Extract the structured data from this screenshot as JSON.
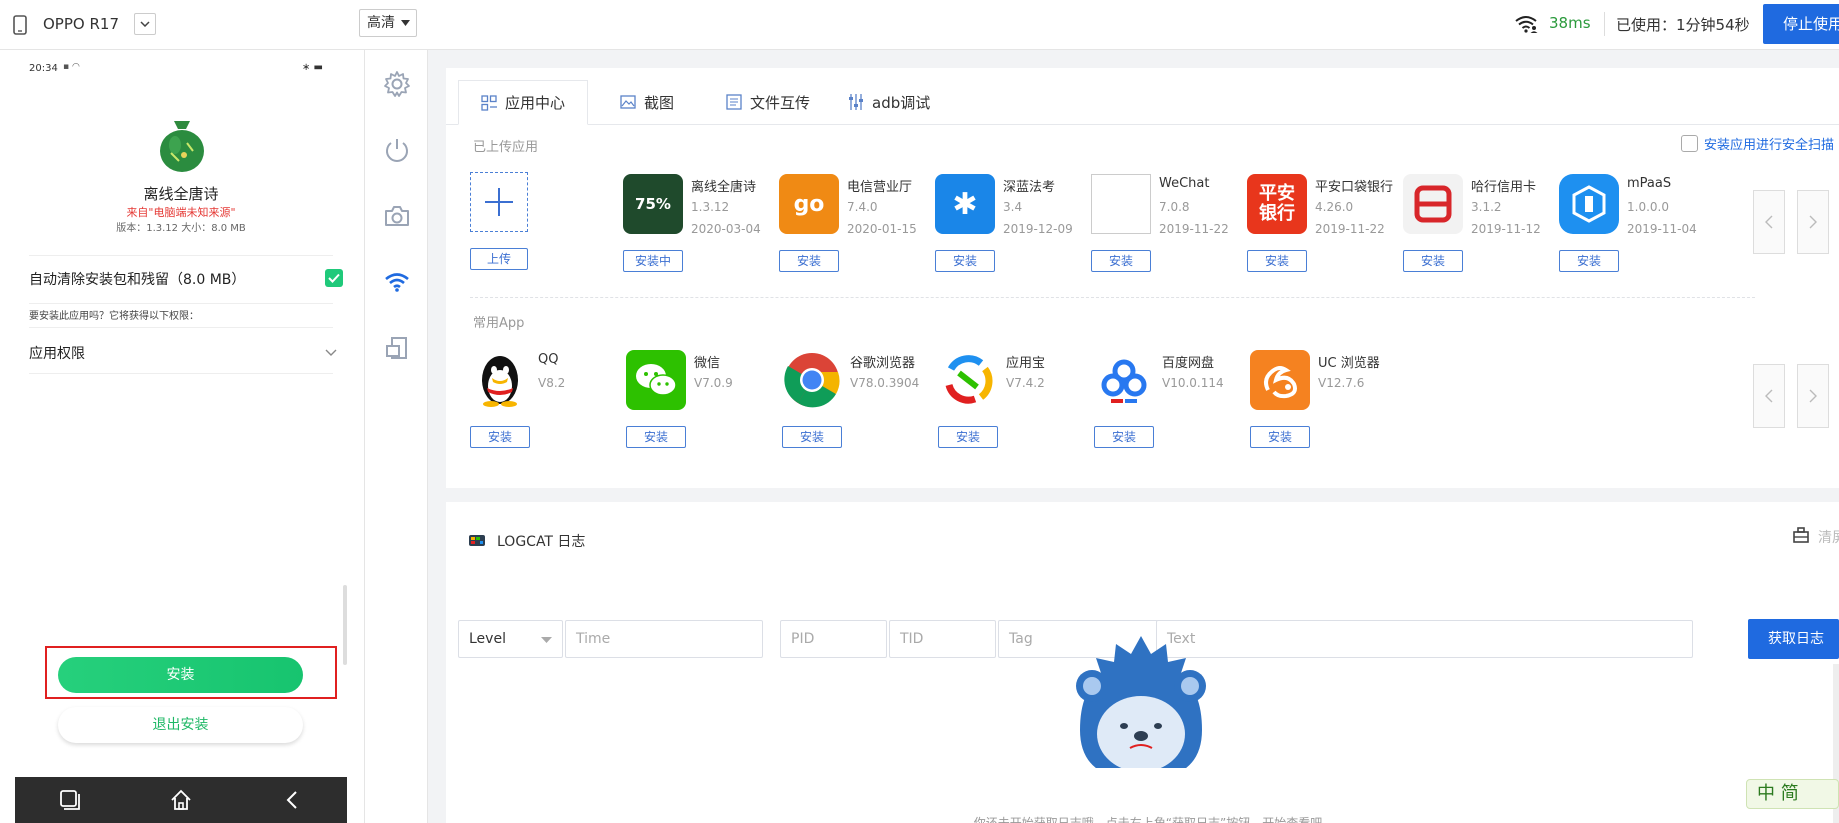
{
  "topbar": {
    "device": "OPPO R17",
    "quality": "高清",
    "latency": "38ms",
    "used_time": "已使用：1分钟54秒",
    "stop_button": "停止使用"
  },
  "phone": {
    "time": "20:34",
    "app_title": "离线全唐诗",
    "source": "来自\"电脑端未知来源\"",
    "version_info": "版本：1.3.12   大小：8.0 MB",
    "auto_clean_label": "自动清除安装包和残留（8.0 MB）",
    "permission_prompt": "要安装此应用吗？它将获得以下权限：",
    "permission_label": "应用权限",
    "install_button": "安装",
    "exit_button": "退出安装"
  },
  "tabs": [
    {
      "label": "应用中心",
      "icon": "app-center-icon"
    },
    {
      "label": "截图",
      "icon": "screenshot-icon"
    },
    {
      "label": "文件互传",
      "icon": "file-transfer-icon"
    },
    {
      "label": "adb调试",
      "icon": "adb-debug-icon"
    }
  ],
  "uploaded": {
    "section_title": "已上传应用",
    "upload_button": "上传",
    "security_scan_label": "安装应用进行安全扫描",
    "apps": [
      {
        "name": "离线全唐诗",
        "version": "1.3.12",
        "date": "2020-03-04",
        "button": "安装中",
        "progress": "75%",
        "color": "#1f4a2c"
      },
      {
        "name": "电信营业厅",
        "version": "7.4.0",
        "date": "2020-01-15",
        "button": "安装",
        "color": "#f08a14"
      },
      {
        "name": "深蓝法考",
        "version": "3.4",
        "date": "2019-12-09",
        "button": "安装",
        "color": "#1a86e8"
      },
      {
        "name": "WeChat",
        "version": "7.0.8",
        "date": "2019-11-22",
        "button": "安装",
        "color": "#ffffff"
      },
      {
        "name": "平安口袋银行",
        "version": "4.26.0",
        "date": "2019-11-22",
        "button": "安装",
        "color": "#e8361c"
      },
      {
        "name": "哈行信用卡",
        "version": "3.1.2",
        "date": "2019-11-12",
        "button": "安装",
        "color": "#f2f2f2"
      },
      {
        "name": "mPaaS",
        "version": "1.0.0.0",
        "date": "2019-11-04",
        "button": "安装",
        "color": "#1e90f0"
      }
    ]
  },
  "common": {
    "section_title": "常用App",
    "apps": [
      {
        "name": "QQ",
        "version": "V8.2",
        "button": "安装"
      },
      {
        "name": "微信",
        "version": "V7.0.9",
        "button": "安装"
      },
      {
        "name": "谷歌浏览器",
        "version": "V78.0.3904",
        "button": "安装"
      },
      {
        "name": "应用宝",
        "version": "V7.4.2",
        "button": "安装"
      },
      {
        "name": "百度网盘",
        "version": "V10.0.114",
        "button": "安装"
      },
      {
        "name": "UC 浏览器",
        "version": "V12.7.6",
        "button": "安装"
      }
    ]
  },
  "logcat": {
    "title": "LOGCAT 日志",
    "clear_label": "清屏",
    "level_placeholder": "Level",
    "time_placeholder": "Time",
    "pid_placeholder": "PID",
    "tid_placeholder": "TID",
    "tag_placeholder": "Tag",
    "text_placeholder": "Text",
    "fetch_button": "获取日志",
    "empty_hint": "你还未开始获取日志哦，点击右上角“获取日志”按钮，开始查看吧"
  },
  "ime_badge": "中 简",
  "colors": {
    "accent": "#1f6ae0",
    "green": "#1fc97a",
    "latency": "#2b9a3c"
  }
}
